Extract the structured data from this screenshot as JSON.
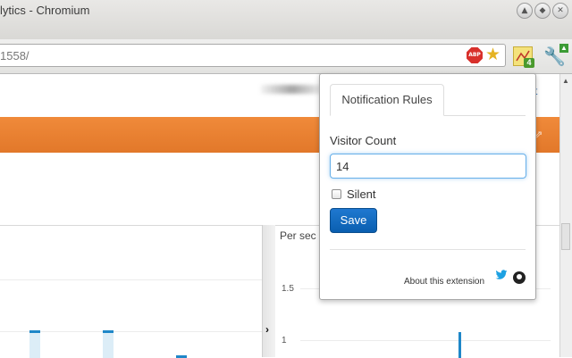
{
  "window": {
    "title": "lytics - Chromium",
    "controls": [
      "minimize",
      "maximize",
      "close"
    ]
  },
  "toolbar": {
    "url": "1558/",
    "abp_label": "ABP",
    "extension_badge": "4"
  },
  "page": {
    "top_link": "t",
    "right_panel_title": "Per sec",
    "y_ticks": [
      "1.5",
      "1"
    ]
  },
  "popup": {
    "tab_label": "Notification Rules",
    "visitor_label": "Visitor Count",
    "visitor_value": "14",
    "silent_label": "Silent",
    "silent_checked": false,
    "save_label": "Save",
    "about_label": "About this extension"
  },
  "colors": {
    "accent_orange": "#e57b2c",
    "primary_blue": "#0a63b8",
    "chart_blue": "#1f87c8"
  }
}
